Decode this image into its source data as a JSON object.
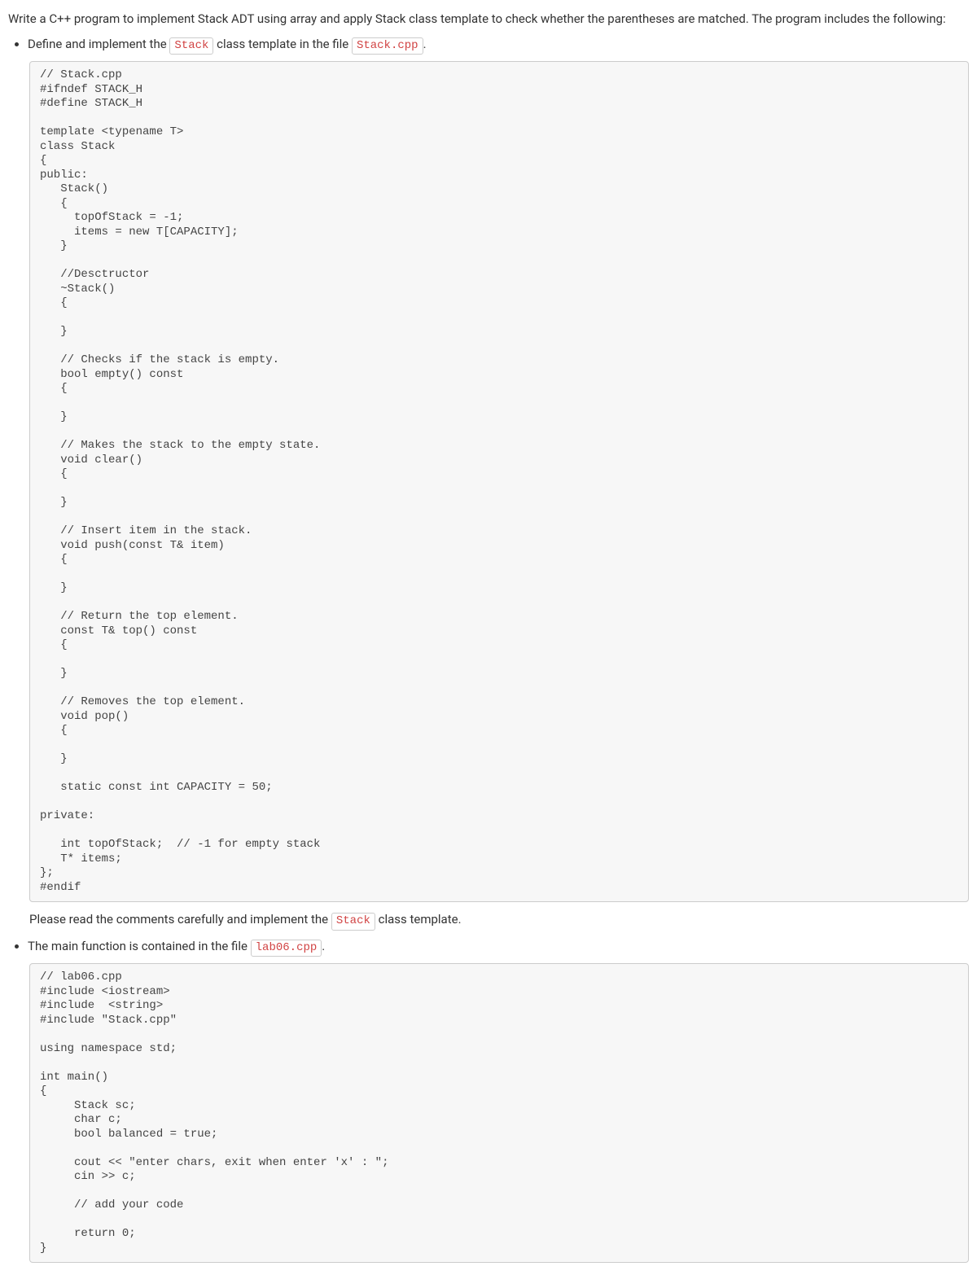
{
  "intro": "Write a C++ program to implement Stack ADT using array and apply Stack class template to check whether the parentheses are matched. The program includes the following:",
  "bullets": {
    "first": {
      "before_tag1": "Define and implement the ",
      "tag1": "Stack",
      "between": " class template in the file ",
      "tag2": "Stack.cpp",
      "after": "."
    },
    "second": {
      "before_tag": "The main function is contained in the file ",
      "tag": "lab06.cpp",
      "after": "."
    }
  },
  "mid_note": {
    "before_tag": "Please read the comments carefully and implement the ",
    "tag": "Stack",
    "after": " class template."
  },
  "code1": "// Stack.cpp\n#ifndef STACK_H\n#define STACK_H\n\ntemplate <typename T>\nclass Stack\n{\npublic:\n   Stack()\n   {\n     topOfStack = -1;\n     items = new T[CAPACITY];\n   }\n\n   //Desctructor\n   ~Stack()\n   {\n\n   }\n\n   // Checks if the stack is empty.\n   bool empty() const\n   {\n\n   }\n\n   // Makes the stack to the empty state.\n   void clear()\n   {\n\n   }\n\n   // Insert item in the stack.\n   void push(const T& item)\n   {\n\n   }\n\n   // Return the top element.\n   const T& top() const\n   {\n\n   }\n\n   // Removes the top element.\n   void pop()\n   {\n\n   }\n\n   static const int CAPACITY = 50;\n\nprivate:\n\n   int topOfStack;  // -1 for empty stack\n   T* items;\n};\n#endif",
  "code2": "// lab06.cpp\n#include <iostream>\n#include  <string>\n#include \"Stack.cpp\"\n\nusing namespace std;\n\nint main()\n{\n     Stack sc;\n     char c;\n     bool balanced = true;\n\n     cout << \"enter chars, exit when enter 'x' : \";\n     cin >> c;\n\n     // add your code\n\n     return 0;\n}"
}
